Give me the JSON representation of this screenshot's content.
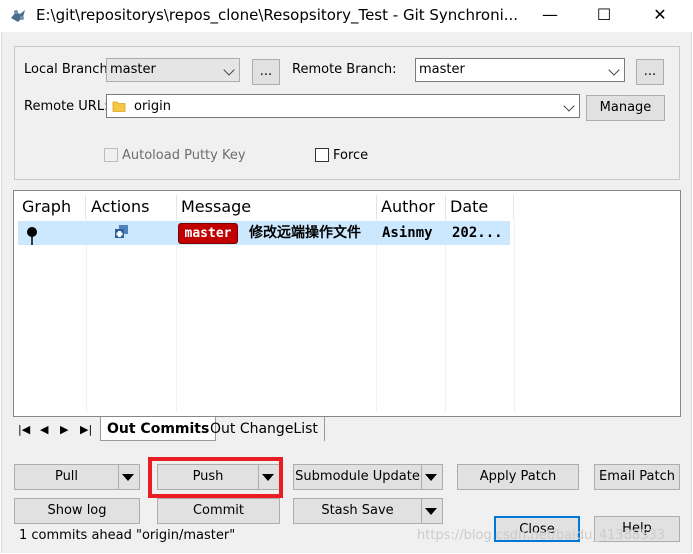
{
  "window": {
    "title": "E:\\git\\repositorys\\repos_clone\\Resopsitory_Test - Git Synchroni...",
    "minimize": "—",
    "maximize": "☐",
    "close": "✕"
  },
  "branches": {
    "local_label": "Local Branch:",
    "local_value": "master",
    "local_browse": "...",
    "remote_label": "Remote Branch:",
    "remote_value": "master",
    "remote_browse": "...",
    "url_label": "Remote URL:",
    "url_value": "origin",
    "manage": "Manage",
    "autoload_label": "Autoload Putty Key",
    "force_label": "Force"
  },
  "commits": {
    "columns": [
      "Graph",
      "Actions",
      "Message",
      "Author",
      "Date"
    ],
    "rows": [
      {
        "branch_badge": "master",
        "message": "修改远端操作文件",
        "author": "Asinmy",
        "date": "202..."
      }
    ]
  },
  "tabs": {
    "nav": [
      "|◀",
      "◀",
      "▶",
      "▶|"
    ],
    "items": [
      "Out Commits",
      "Out ChangeList"
    ],
    "active": "Out Commits"
  },
  "buttons": {
    "pull": "Pull",
    "push": "Push",
    "submodule_update": "Submodule Update",
    "apply_patch": "Apply Patch",
    "email_patch": "Email Patch",
    "show_log": "Show log",
    "commit": "Commit",
    "stash_save": "Stash Save",
    "close": "Close",
    "help": "Help"
  },
  "status": "1 commits ahead \"origin/master\"",
  "watermark": "https://blog.csdn.net/baidu_41388533",
  "colors": {
    "badge": "#c00000",
    "selection": "#cce8ff",
    "highlight": "#e81e24",
    "dialog_bg": "#f0f0f0"
  }
}
